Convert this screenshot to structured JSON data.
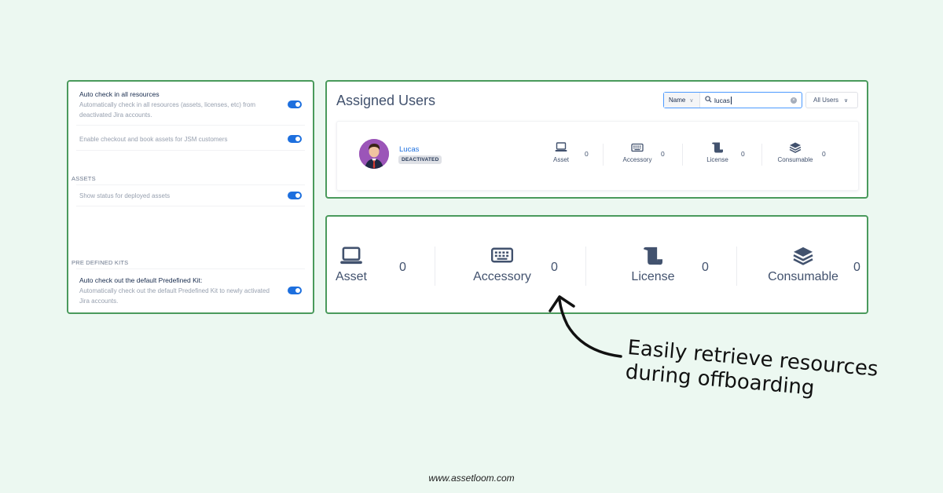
{
  "settings": {
    "auto_checkin": {
      "title": "Auto check in all resources",
      "desc": "Automatically check in all resources (assets, licenses, etc) from deactivated Jira accounts.",
      "enabled": true
    },
    "jsm_checkout": {
      "title": "Enable checkout and book assets for JSM customers",
      "enabled": true
    },
    "assets_section": "ASSETS",
    "deployed_status": {
      "title": "Show status for deployed assets",
      "enabled": true
    },
    "kits_section": "PRE DEFINED KITS",
    "auto_kit": {
      "title": "Auto check out the default Predefined Kit:",
      "desc": "Automatically check out the default Predefined Kit to newly activated Jira accounts.",
      "enabled": true
    }
  },
  "assigned": {
    "title": "Assigned Users",
    "search_by": "Name",
    "search_value": "lucas",
    "filter": "All Users",
    "user": {
      "name": "Lucas",
      "status": "DEACTIVATED"
    },
    "resources": [
      {
        "label": "Asset",
        "count": "0",
        "icon": "laptop-icon"
      },
      {
        "label": "Accessory",
        "count": "0",
        "icon": "keyboard-icon"
      },
      {
        "label": "License",
        "count": "0",
        "icon": "scroll-icon"
      },
      {
        "label": "Consumable",
        "count": "0",
        "icon": "layers-icon"
      }
    ]
  },
  "zoomed": {
    "resources": [
      {
        "label": "Asset",
        "count": "0",
        "icon": "laptop-icon"
      },
      {
        "label": "Accessory",
        "count": "0",
        "icon": "keyboard-icon"
      },
      {
        "label": "License",
        "count": "0",
        "icon": "scroll-icon"
      },
      {
        "label": "Consumable",
        "count": "0",
        "icon": "layers-icon"
      }
    ]
  },
  "annotation": {
    "line1": "Easily retrieve resources",
    "line2": "during offboarding"
  },
  "website": "www.assetloom.com",
  "colors": {
    "background": "#ecf8f1",
    "panel_border": "#4a9a5c",
    "toggle_on": "#1d6fde",
    "link": "#1d6fde"
  }
}
